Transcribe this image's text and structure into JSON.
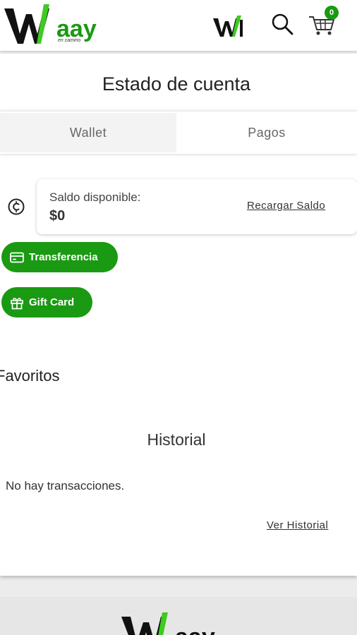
{
  "header": {
    "logo_text": "Waay",
    "logo_subtitle": "en camino",
    "cart_count": "0",
    "icons": [
      "brand-logo",
      "search-icon",
      "cart-icon"
    ]
  },
  "page": {
    "title": "Estado de cuenta"
  },
  "tabs": [
    {
      "label": "Wallet",
      "active": true
    },
    {
      "label": "Pagos",
      "active": false
    }
  ],
  "balance": {
    "label": "Saldo disponible:",
    "value": "$0",
    "recharge_label": "Recargar Saldo"
  },
  "actions": {
    "transfer_label": "Transferencia",
    "giftcard_label": "Gift Card"
  },
  "favorites": {
    "title": "Favoritos"
  },
  "history": {
    "title": "Historial",
    "empty_message": "No hay transacciones.",
    "view_link": "Ver Historial"
  },
  "colors": {
    "brand_green": "#1a9a12",
    "accent_green": "#3ecb1f",
    "logo_dark": "#111111"
  }
}
